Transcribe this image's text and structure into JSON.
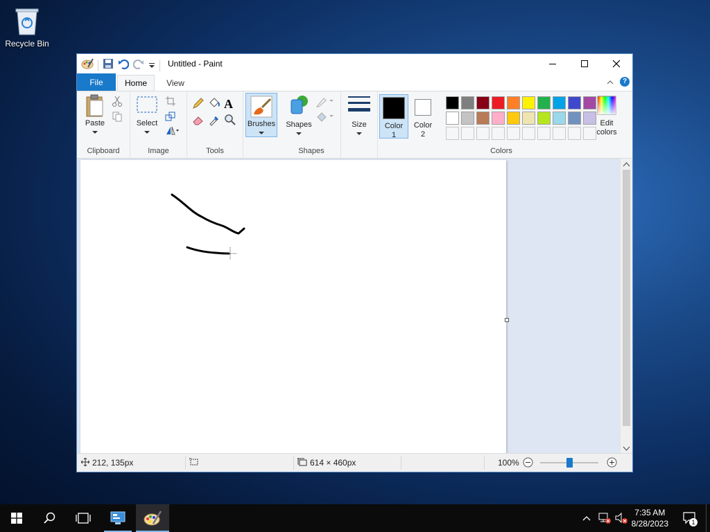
{
  "desktop": {
    "recycle_bin_label": "Recycle Bin"
  },
  "window": {
    "title": "Untitled - Paint",
    "tabs": {
      "file": "File",
      "home": "Home",
      "view": "View"
    },
    "help": "?"
  },
  "ribbon": {
    "clipboard": {
      "paste": "Paste",
      "label": "Clipboard"
    },
    "image": {
      "select": "Select",
      "label": "Image"
    },
    "tools": {
      "label": "Tools",
      "text_tool": "A"
    },
    "brushes": {
      "label": "Brushes"
    },
    "shapes": {
      "shapes": "Shapes",
      "label": "Shapes"
    },
    "size": {
      "label": "Size"
    },
    "colors": {
      "color1_line1": "Color",
      "color1_line2": "1",
      "color2_line1": "Color",
      "color2_line2": "2",
      "edit_line1": "Edit",
      "edit_line2": "colors",
      "label": "Colors",
      "color1": "#000000",
      "color2": "#ffffff",
      "row1": [
        "#000000",
        "#7f7f7f",
        "#880015",
        "#ed1c24",
        "#ff7f27",
        "#fff200",
        "#22b14c",
        "#00a2e8",
        "#3f48cc",
        "#a349a4"
      ],
      "row2": [
        "#ffffff",
        "#c3c3c3",
        "#b97a57",
        "#ffaec9",
        "#ffc90e",
        "#efe4b0",
        "#b5e61d",
        "#99d9ea",
        "#7092be",
        "#c8bfe7"
      ]
    }
  },
  "status": {
    "cursor_pos": "212, 135px",
    "canvas_size": "614 × 460px",
    "zoom": "100%",
    "zoom_level": 0.5
  },
  "taskbar": {
    "time": "7:35 AM",
    "date": "8/28/2023",
    "notification_count": "1"
  }
}
